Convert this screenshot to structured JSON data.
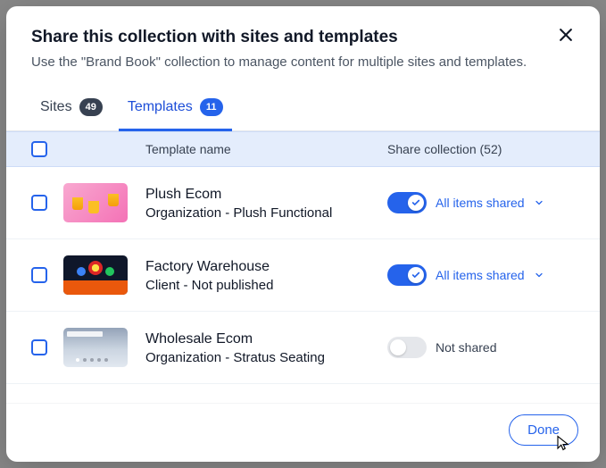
{
  "header": {
    "title": "Share this collection with sites and templates",
    "subtitle": "Use the \"Brand Book\" collection to manage content for multiple sites and templates."
  },
  "tabs": {
    "sites": {
      "label": "Sites",
      "count": "49"
    },
    "templates": {
      "label": "Templates",
      "count": "11"
    }
  },
  "columns": {
    "name": "Template name",
    "share": "Share collection (52)"
  },
  "shareStates": {
    "allShared": "All items shared",
    "notShared": "Not shared"
  },
  "rows": [
    {
      "name": "Plush Ecom",
      "sub": "Organization - Plush Functional",
      "shared": true
    },
    {
      "name": "Factory Warehouse",
      "sub": "Client - Not published",
      "shared": true
    },
    {
      "name": "Wholesale Ecom",
      "sub": "Organization - Stratus Seating",
      "shared": false
    }
  ],
  "footer": {
    "done": "Done"
  }
}
